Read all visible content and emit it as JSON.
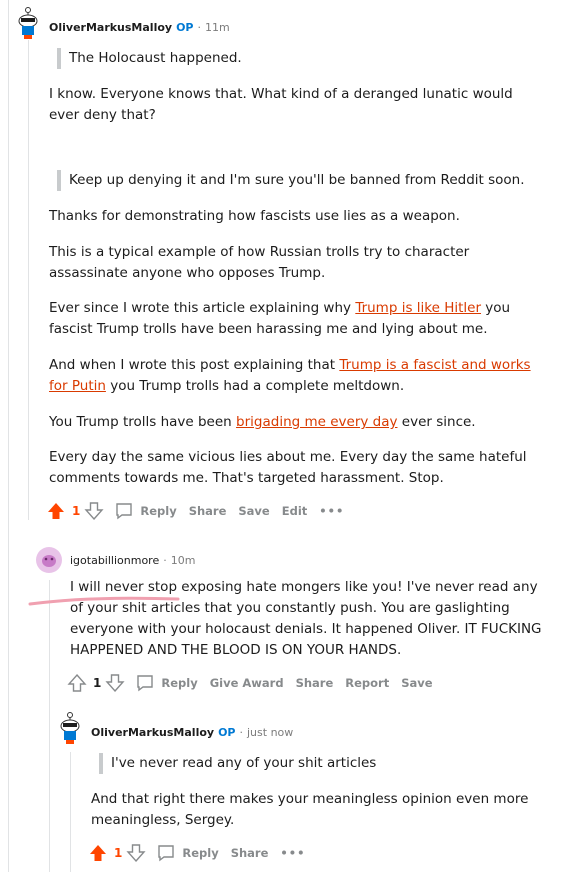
{
  "comments": [
    {
      "username": "OliverMarkusMalloy",
      "op_badge": "OP",
      "time": "11m",
      "quote1": "The Holocaust happened.",
      "p1": "I know. Everyone knows that. What kind of a deranged lunatic would ever deny that?",
      "quote2": "Keep up denying it and I'm sure you'll be banned from Reddit soon.",
      "p2": "Thanks for demonstrating how fascists use lies as a weapon.",
      "p3": "This is a typical example of how Russian trolls try to character assassinate anyone who opposes Trump.",
      "p4_a": "Ever since I wrote this article explaining why ",
      "p4_link": "Trump is like Hitler",
      "p4_b": " you fascist Trump trolls have been harassing me and lying about me.",
      "p5_a": "And when I wrote this post explaining that ",
      "p5_link": "Trump is a fascist and works for Putin",
      "p5_b": " you Trump trolls had a complete meltdown.",
      "p6_a": "You Trump trolls have been ",
      "p6_link": "brigading me every day",
      "p6_b": " ever since.",
      "p7": "Every day the same vicious lies about me. Every day the same hateful comments towards me. That's targeted harassment. Stop.",
      "score": "1",
      "actions": [
        "Reply",
        "Share",
        "Save",
        "Edit"
      ],
      "more": "•••"
    },
    {
      "username": "igotabillionmore",
      "time": "10m",
      "body": "I will never stop exposing hate mongers like you! I've never read any of your shit articles that you constantly push. You are gaslighting everyone with your holocaust denials. It happened Oliver. IT FUCKING HAPPENED AND THE BLOOD IS ON YOUR HANDS.",
      "score": "1",
      "actions": [
        "Reply",
        "Give Award",
        "Share",
        "Report",
        "Save"
      ]
    },
    {
      "username": "OliverMarkusMalloy",
      "op_badge": "OP",
      "time": "just now",
      "quote": "I've never read any of your shit articles",
      "p1": "And that right there makes your meaningless opinion even more meaningless, Sergey.",
      "score": "1",
      "actions": [
        "Reply",
        "Share"
      ],
      "more": "•••"
    }
  ],
  "colors": {
    "upvote_active": "#ff4500",
    "link": "#d93a00",
    "op": "#0079d3",
    "marker": "#f0a0b0"
  }
}
